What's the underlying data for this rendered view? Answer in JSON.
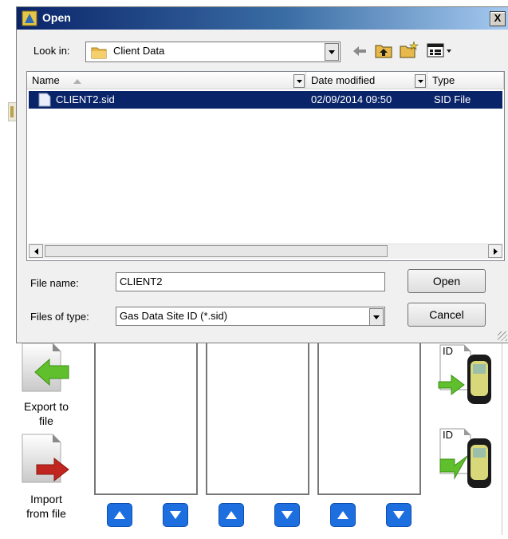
{
  "dialog": {
    "title": "Open",
    "close_label": "X",
    "look_in_label": "Look in:",
    "look_in_value": "Client Data",
    "columns": [
      "Name",
      "Date modified",
      "Type"
    ],
    "files": [
      {
        "name": "CLIENT2.sid",
        "date": "02/09/2014 09:50",
        "type": "SID File",
        "selected": true
      }
    ],
    "file_name_label": "File name:",
    "file_name_value": "CLIENT2",
    "files_of_type_label": "Files of type:",
    "files_of_type_value": "Gas Data Site ID (*.sid)",
    "open_label": "Open",
    "cancel_label": "Cancel"
  },
  "app": {
    "export_label_line1": "Export to",
    "export_label_line2": "file",
    "import_label_line1": "Import",
    "import_label_line2": "from file",
    "device_id_label": "ID",
    "arrow_buttons": [
      "up",
      "down",
      "up",
      "down",
      "up",
      "down"
    ]
  },
  "colors": {
    "selection": "#0a246a",
    "arrow_button_blue": "#1d6fe0",
    "export_arrow_green": "#5fbf2c",
    "import_arrow_red": "#c0261f"
  }
}
